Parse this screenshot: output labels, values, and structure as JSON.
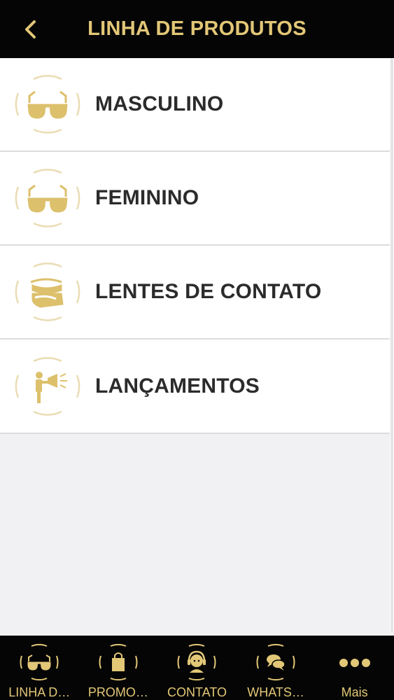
{
  "header": {
    "title": "LINHA DE PRODUTOS",
    "back_icon": "chevron-left-icon"
  },
  "colors": {
    "gold": "#e2c777",
    "header_bg": "#050505",
    "row_text": "#2b2b2b",
    "background": "#f1f1f3"
  },
  "products": [
    {
      "label": "MASCULINO",
      "icon": "sunglasses-icon"
    },
    {
      "label": "FEMININO",
      "icon": "sunglasses-icon"
    },
    {
      "label": "LENTES DE CONTATO",
      "icon": "contact-lens-icon"
    },
    {
      "label": "LANÇAMENTOS",
      "icon": "megaphone-person-icon"
    }
  ],
  "tabbar": {
    "tabs": [
      {
        "label": "LINHA D…",
        "icon": "sunglasses-icon"
      },
      {
        "label": "PROMO…",
        "icon": "shopping-bag-icon"
      },
      {
        "label": "CONTATO",
        "icon": "headset-person-icon"
      },
      {
        "label": "WHATS…",
        "icon": "chat-bubbles-icon"
      },
      {
        "label": "Mais",
        "icon": "more-dots-icon"
      }
    ]
  }
}
